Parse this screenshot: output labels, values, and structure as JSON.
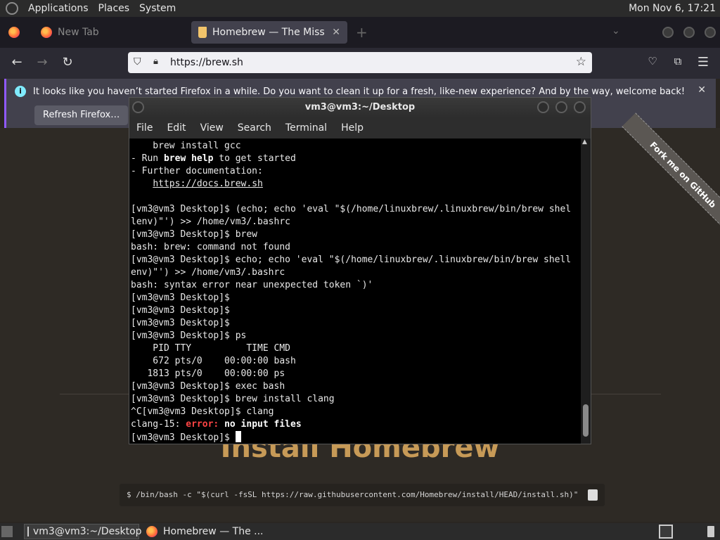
{
  "top_panel": {
    "menus": [
      "Applications",
      "Places",
      "System"
    ],
    "clock": "Mon Nov  6, 17:21"
  },
  "firefox": {
    "tabs": [
      {
        "title": "New Tab"
      },
      {
        "title": "Homebrew — The Missing P"
      }
    ],
    "url": "https://brew.sh",
    "notice": {
      "message": "It looks like you haven’t started Firefox in a while. Do you want to clean it up for a fresh, like-new experience? And by the way, welcome back!",
      "button_label": "Refresh Firefox…"
    }
  },
  "page": {
    "ribbon": "Fork me on GitHub",
    "heading": "Install Homebrew",
    "install_command": "$ /bin/bash -c \"$(curl -fsSL https://raw.githubusercontent.com/Homebrew/install/HEAD/install.sh)\""
  },
  "terminal": {
    "title": "vm3@vm3:~/Desktop",
    "menus": [
      "File",
      "Edit",
      "View",
      "Search",
      "Terminal",
      "Help"
    ],
    "lines": [
      "    brew install gcc",
      "- Run brew help to get started",
      "- Further documentation:",
      "    https://docs.brew.sh",
      "",
      "[vm3@vm3 Desktop]$ (echo; echo 'eval \"$(/home/linuxbrew/.linuxbrew/bin/brew shel",
      "lenv)\"') >> /home/vm3/.bashrc",
      "[vm3@vm3 Desktop]$ brew",
      "bash: brew: command not found",
      "[vm3@vm3 Desktop]$ echo; echo 'eval \"$(/home/linuxbrew/.linuxbrew/bin/brew shell",
      "env)\"') >> /home/vm3/.bashrc",
      "bash: syntax error near unexpected token `)'",
      "[vm3@vm3 Desktop]$",
      "[vm3@vm3 Desktop]$",
      "[vm3@vm3 Desktop]$",
      "[vm3@vm3 Desktop]$ ps",
      "    PID TTY          TIME CMD",
      "    672 pts/0    00:00:00 bash",
      "   1813 pts/0    00:00:00 ps",
      "[vm3@vm3 Desktop]$ exec bash",
      "[vm3@vm3 Desktop]$ brew install clang",
      "^C[vm3@vm3 Desktop]$ clang",
      "clang-15: error: no input files",
      "[vm3@vm3 Desktop]$ "
    ]
  },
  "taskbar": {
    "tasks": [
      "vm3@vm3:~/Desktop",
      "Homebrew — The ..."
    ]
  }
}
